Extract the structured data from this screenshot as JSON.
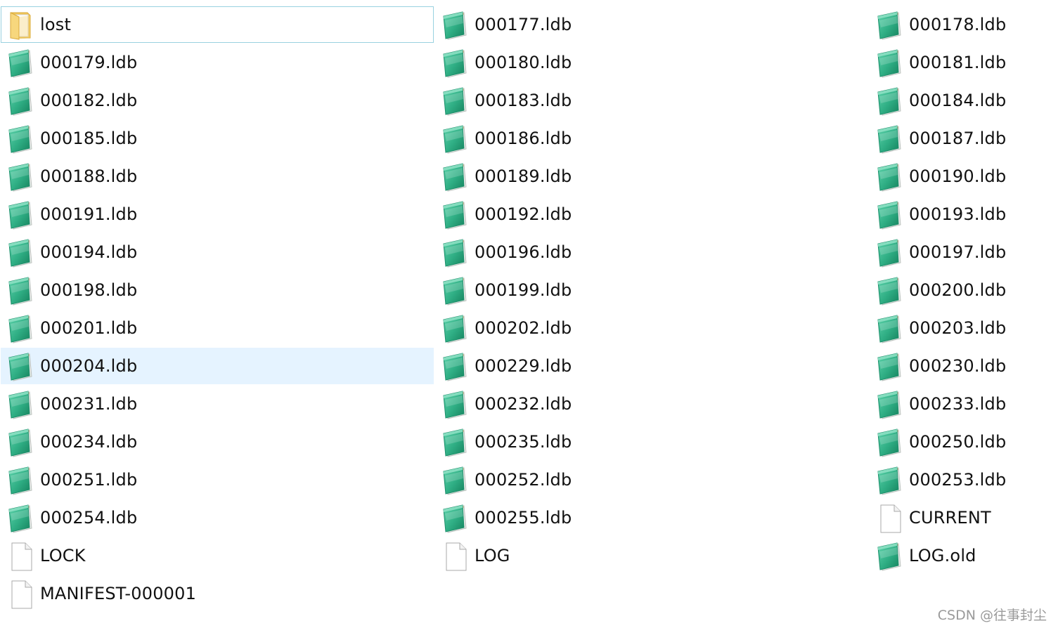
{
  "files": [
    {
      "name": "lost",
      "type": "folder",
      "state": "focused"
    },
    {
      "name": "000177.ldb",
      "type": "notepad"
    },
    {
      "name": "000178.ldb",
      "type": "notepad"
    },
    {
      "name": "000179.ldb",
      "type": "notepad"
    },
    {
      "name": "000180.ldb",
      "type": "notepad"
    },
    {
      "name": "000181.ldb",
      "type": "notepad"
    },
    {
      "name": "000182.ldb",
      "type": "notepad"
    },
    {
      "name": "000183.ldb",
      "type": "notepad"
    },
    {
      "name": "000184.ldb",
      "type": "notepad"
    },
    {
      "name": "000185.ldb",
      "type": "notepad"
    },
    {
      "name": "000186.ldb",
      "type": "notepad"
    },
    {
      "name": "000187.ldb",
      "type": "notepad"
    },
    {
      "name": "000188.ldb",
      "type": "notepad"
    },
    {
      "name": "000189.ldb",
      "type": "notepad"
    },
    {
      "name": "000190.ldb",
      "type": "notepad"
    },
    {
      "name": "000191.ldb",
      "type": "notepad"
    },
    {
      "name": "000192.ldb",
      "type": "notepad"
    },
    {
      "name": "000193.ldb",
      "type": "notepad"
    },
    {
      "name": "000194.ldb",
      "type": "notepad"
    },
    {
      "name": "000196.ldb",
      "type": "notepad"
    },
    {
      "name": "000197.ldb",
      "type": "notepad"
    },
    {
      "name": "000198.ldb",
      "type": "notepad"
    },
    {
      "name": "000199.ldb",
      "type": "notepad"
    },
    {
      "name": "000200.ldb",
      "type": "notepad"
    },
    {
      "name": "000201.ldb",
      "type": "notepad"
    },
    {
      "name": "000202.ldb",
      "type": "notepad"
    },
    {
      "name": "000203.ldb",
      "type": "notepad"
    },
    {
      "name": "000204.ldb",
      "type": "notepad",
      "state": "hovered"
    },
    {
      "name": "000229.ldb",
      "type": "notepad"
    },
    {
      "name": "000230.ldb",
      "type": "notepad"
    },
    {
      "name": "000231.ldb",
      "type": "notepad"
    },
    {
      "name": "000232.ldb",
      "type": "notepad"
    },
    {
      "name": "000233.ldb",
      "type": "notepad"
    },
    {
      "name": "000234.ldb",
      "type": "notepad"
    },
    {
      "name": "000235.ldb",
      "type": "notepad"
    },
    {
      "name": "000250.ldb",
      "type": "notepad"
    },
    {
      "name": "000251.ldb",
      "type": "notepad"
    },
    {
      "name": "000252.ldb",
      "type": "notepad"
    },
    {
      "name": "000253.ldb",
      "type": "notepad"
    },
    {
      "name": "000254.ldb",
      "type": "notepad"
    },
    {
      "name": "000255.ldb",
      "type": "notepad"
    },
    {
      "name": "CURRENT",
      "type": "blank"
    },
    {
      "name": "LOCK",
      "type": "blank"
    },
    {
      "name": "LOG",
      "type": "blank"
    },
    {
      "name": "LOG.old",
      "type": "notepad"
    },
    {
      "name": "MANIFEST-000001",
      "type": "blank"
    }
  ],
  "icons": {
    "folder": "folder-icon",
    "notepad": "notepad-file-icon",
    "blank": "blank-file-icon"
  },
  "colors": {
    "focus_border": "#99d1e0",
    "hover_background": "#e5f3ff",
    "notepad_green": "#2fae84",
    "folder_yellow": "#f3cf6a"
  },
  "watermark": "CSDN @往事封尘"
}
